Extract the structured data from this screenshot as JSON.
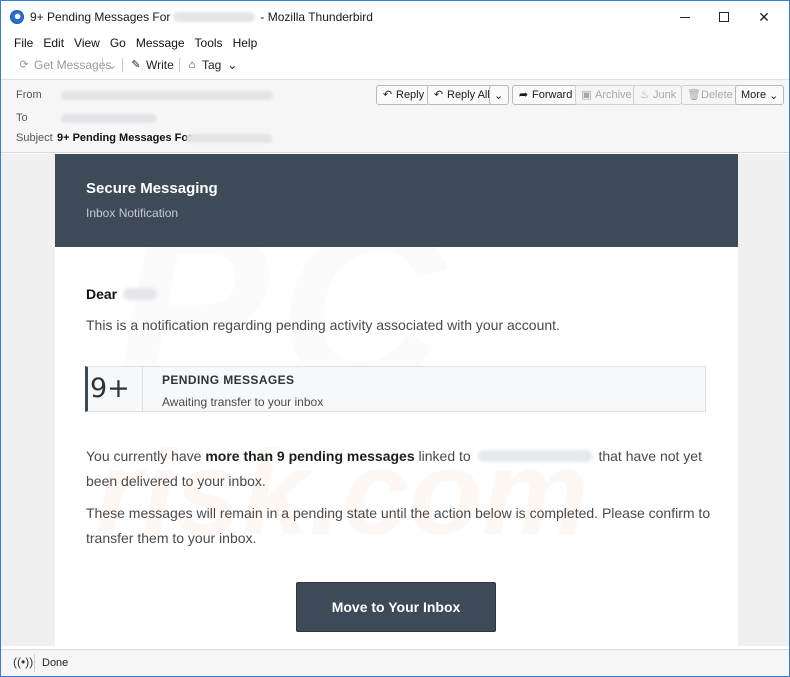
{
  "window": {
    "title_prefix": "9+ Pending Messages For",
    "title_suffix": "- Mozilla Thunderbird",
    "controls": {
      "minimize": "",
      "maximize": "",
      "close": "✕"
    }
  },
  "menu": [
    "File",
    "Edit",
    "View",
    "Go",
    "Message",
    "Tools",
    "Help"
  ],
  "toolbar": {
    "get_messages": "Get Messages",
    "write": "Write",
    "tag": "Tag"
  },
  "header": {
    "from_label": "From",
    "to_label": "To",
    "subject_label": "Subject",
    "subject_value": "9+ Pending Messages For",
    "buttons": {
      "reply": "Reply",
      "reply_all": "Reply All",
      "forward": "Forward",
      "archive": "Archive",
      "junk": "Junk",
      "delete": "Delete",
      "more": "More"
    }
  },
  "email": {
    "banner_title": "Secure Messaging",
    "banner_subtitle": "Inbox Notification",
    "greeting": "Dear",
    "intro": "This is a notification regarding pending activity associated with your account.",
    "pending_count": "9+",
    "pending_title": "PENDING MESSAGES",
    "pending_subtitle": "Awaiting transfer to your inbox",
    "body_part1": "You currently have ",
    "body_bold": "more than 9 pending messages",
    "body_part2": " linked to ",
    "body_part3": " that have not yet been delivered to your inbox.",
    "body2": "These messages will remain in a pending state until the action below is completed. Please confirm to transfer them to your inbox.",
    "cta": "Move to Your Inbox"
  },
  "watermark": {
    "large": "PC",
    "small": "risk.com"
  },
  "status": {
    "text": "Done"
  }
}
